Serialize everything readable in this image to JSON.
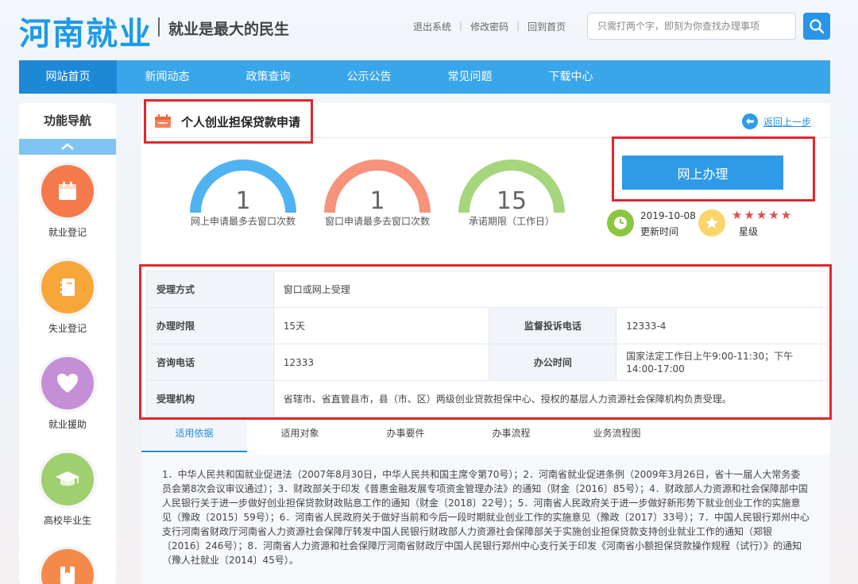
{
  "header": {
    "logo": "河南就业",
    "slogan": "就业是最大的民生",
    "links": [
      "退出系统",
      "修改密码",
      "回到首页"
    ],
    "search_placeholder": "只需打两个字，即刻为你查找办理事项"
  },
  "nav": {
    "items": [
      "网站首页",
      "新闻动态",
      "政策查询",
      "公示公告",
      "常见问题",
      "下载中心"
    ]
  },
  "sidebar": {
    "title": "功能导航",
    "items": [
      {
        "label": "就业登记",
        "color": "#f47a4c",
        "icon": "calendar-icon"
      },
      {
        "label": "失业登记",
        "color": "#f7a63a",
        "icon": "notebook-icon"
      },
      {
        "label": "就业援助",
        "color": "#c58fd8",
        "icon": "heart-icon"
      },
      {
        "label": "高校毕业生",
        "color": "#9fcf6f",
        "icon": "graduation-cap-icon"
      },
      {
        "label": "",
        "color": "#f48a4a",
        "icon": "bookmark-icon"
      }
    ]
  },
  "service": {
    "title": "个人创业担保贷款申请",
    "back": "返回上一步",
    "online_button": "网上办理",
    "gauges": [
      {
        "value": "1",
        "label": "网上申请最多去窗口次数",
        "color": "#4fb3f2"
      },
      {
        "value": "1",
        "label": "窗口申请最多去窗口次数",
        "color": "#f6937a"
      },
      {
        "value": "15",
        "label": "承诺期限（工作日）",
        "color": "#a6d67c"
      }
    ],
    "update_date": "2019-10-08",
    "update_label": "更新时间",
    "stars": "★★★★★",
    "star_label": "星级",
    "colors": {
      "accent": "#1e8ee0",
      "highlight": "#e3262d"
    }
  },
  "info": {
    "mode_k": "受理方式",
    "mode_v": "窗口或网上受理",
    "limit_k": "办理时限",
    "limit_v": "15天",
    "complaint_k": "监督投诉电话",
    "complaint_v": "12333-4",
    "phone_k": "咨询电话",
    "phone_v": "12333",
    "hours_k": "办公时间",
    "hours_v": "国家法定工作日上午9:00-11:30；下午14:00-17:00",
    "org_k": "受理机构",
    "org_v": "省辖市、省直管县市，县（市、区）两级创业贷款担保中心、授权的基层人力资源社会保障机构负责受理。"
  },
  "tabs": [
    "适用依据",
    "适用对象",
    "办事要件",
    "办事流程",
    "业务流程图"
  ],
  "basis_text": "1．中华人民共和国就业促进法（2007年8月30日，中华人民共和国主席令第70号）；2．河南省就业促进条例（2009年3月26日，省十一届人大常务委员会第8次会议审议通过）；3．财政部关于印发《普惠金融发展专项资金管理办法》的通知（财金〔2016〕85号）；4．财政部人力资源和社会保障部中国人民银行关于进一步做好创业担保贷款财政贴息工作的通知（财金〔2018〕22号）；5．河南省人民政府关于进一步做好新形势下就业创业工作的实施意见（豫政〔2015〕59号）；6．河南省人民政府关于做好当前和今后一段时期就业创业工作的实施意见（豫政〔2017〕33号）；7．中国人民银行郑州中心支行河南省财政厅河南省人力资源社会保障厅转发中国人民银行财政部人力资源社会保障部关于实施创业担保贷款支持创业就业工作的通知（郑银〔2016〕246号）；8．河南省人力资源和社会保障厅河南省财政厅中国人民银行郑州中心支行关于印发《河南省小额担保贷款操作规程（试行）》的通知（豫人社就业〔2014〕45号）。"
}
